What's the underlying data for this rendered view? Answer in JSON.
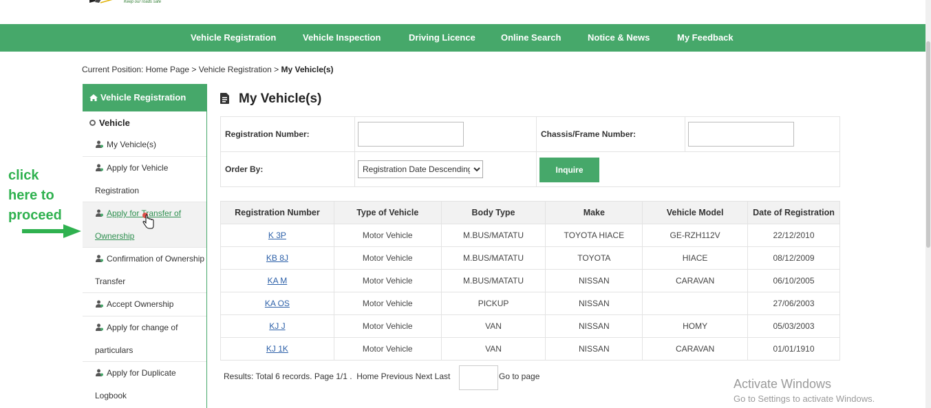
{
  "header": {
    "logo_tagline": "Keep our roads safe"
  },
  "nav": {
    "items": [
      "Vehicle Registration",
      "Vehicle Inspection",
      "Driving Licence",
      "Online Search",
      "Notice & News",
      "My Feedback"
    ]
  },
  "breadcrumb": {
    "prefix": "Current Position: Home Page > Vehicle Registration > ",
    "current": "My Vehicle(s)"
  },
  "sidebar": {
    "header": "Vehicle Registration",
    "group": "Vehicle",
    "items": [
      {
        "line1": "My Vehicle(s)",
        "line2": ""
      },
      {
        "line1": "Apply for Vehicle",
        "line2": "Registration"
      },
      {
        "line1": "Apply for Transfer of",
        "line2": "Ownership"
      },
      {
        "line1": "Confirmation of Ownership",
        "line2": "Transfer"
      },
      {
        "line1": "Accept Ownership",
        "line2": ""
      },
      {
        "line1": "Apply for change of",
        "line2": "particulars"
      },
      {
        "line1": "Apply for Duplicate",
        "line2": "Logbook"
      }
    ],
    "active_index": 2
  },
  "annotation": {
    "lines": [
      "click",
      "here to",
      "proceed"
    ],
    "color": "#2fb14f"
  },
  "main": {
    "title": "My Vehicle(s)",
    "form": {
      "reg_label": "Registration Number:",
      "reg_value": "",
      "chassis_label": "Chassis/Frame Number:",
      "chassis_value": "",
      "order_label": "Order By:",
      "order_selected": "Registration Date Descending",
      "inquire_label": "Inquire"
    },
    "table": {
      "columns": [
        "Registration Number",
        "Type of Vehicle",
        "Body Type",
        "Make",
        "Vehicle Model",
        "Date of Registration"
      ],
      "rows": [
        [
          "K      3P",
          "Motor Vehicle",
          "M.BUS/MATATU",
          "TOYOTA HIACE",
          "GE-RZH112V",
          "22/12/2010"
        ],
        [
          "KB     8J",
          "Motor Vehicle",
          "M.BUS/MATATU",
          "TOYOTA",
          "HIACE",
          "08/12/2009"
        ],
        [
          "KA     M",
          "Motor Vehicle",
          "M.BUS/MATATU",
          "NISSAN",
          "CARAVAN",
          "06/10/2005"
        ],
        [
          "KA     OS",
          "Motor Vehicle",
          "PICKUP",
          "NISSAN",
          "",
          "27/06/2003"
        ],
        [
          "KJ     J",
          "Motor Vehicle",
          "VAN",
          "NISSAN",
          "HOMY",
          "05/03/2003"
        ],
        [
          "KJ     1K",
          "Motor Vehicle",
          "VAN",
          "NISSAN",
          "CARAVAN",
          "01/01/1910"
        ]
      ]
    },
    "pager": {
      "results": "Results: Total 6 records. Page 1/1 .",
      "home": "Home",
      "previous": "Previous",
      "next": "Next",
      "last": "Last",
      "page_value": "",
      "goto": "Go to page"
    }
  },
  "watermark": {
    "line1": "Activate Windows",
    "line2": "Go to Settings to activate Windows."
  },
  "colors": {
    "brand_green": "#46a86a",
    "link_blue": "#2b5fa8"
  }
}
